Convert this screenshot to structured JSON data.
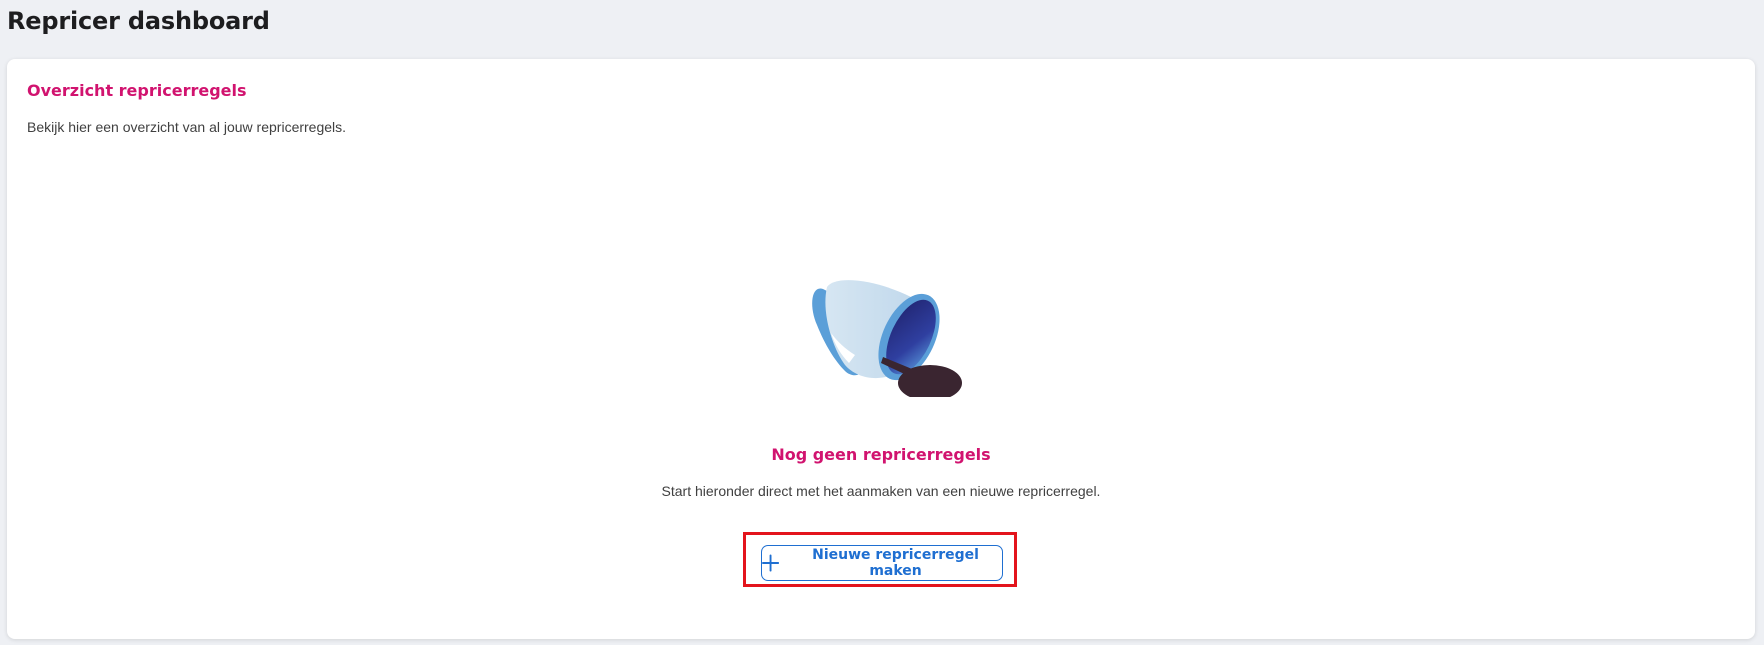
{
  "header": {
    "title": "Repricer dashboard"
  },
  "card": {
    "title": "Overzicht repricerregels",
    "subtitle": "Bekijk hier een overzicht van al jouw repricerregels."
  },
  "empty_state": {
    "illustration": "spilled-cup-icon",
    "title": "Nog geen repricerregels",
    "text": "Start hieronder direct met het aanmaken van een nieuwe repricerregel.",
    "button_icon": "plus-icon",
    "button_label": "Nieuwe repricerregel maken"
  },
  "colors": {
    "background": "#eef0f4",
    "accent": "#d1136f",
    "button": "#1f6fd1",
    "highlight": "#e3141c"
  }
}
